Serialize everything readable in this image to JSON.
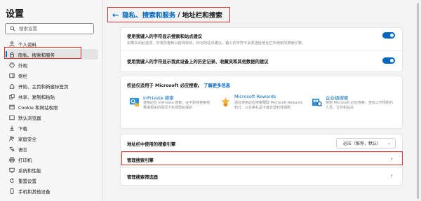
{
  "sidebar": {
    "title": "设置",
    "search_placeholder": "搜索设置",
    "items": [
      {
        "label": "个人资料",
        "icon": "profile-icon"
      },
      {
        "label": "隐私、搜索和服务",
        "icon": "lock-icon",
        "active": true
      },
      {
        "label": "外观",
        "icon": "appearance-icon"
      },
      {
        "label": "侧栏",
        "icon": "sidebar-icon"
      },
      {
        "label": "开始、主页和新建标签页",
        "icon": "home-icon"
      },
      {
        "label": "共享、复制和粘贴",
        "icon": "share-icon"
      },
      {
        "label": "Cookie 和网站权限",
        "icon": "cookie-icon"
      },
      {
        "label": "默认浏览器",
        "icon": "browser-icon"
      },
      {
        "label": "下载",
        "icon": "download-icon"
      },
      {
        "label": "家庭安全",
        "icon": "family-icon"
      },
      {
        "label": "语言",
        "icon": "language-icon"
      },
      {
        "label": "打印机",
        "icon": "printer-icon"
      },
      {
        "label": "系统和性能",
        "icon": "system-icon"
      },
      {
        "label": "重置设置",
        "icon": "reset-icon"
      },
      {
        "label": "手机和其他设备",
        "icon": "phone-icon"
      }
    ]
  },
  "header": {
    "back_glyph": "←",
    "crumb": "隐私、搜索和服务",
    "separator": "/",
    "current": "地址栏和搜索"
  },
  "suggestions": {
    "toggle1_label": "使用我键入的字符显示搜索和站点建议",
    "toggle1_desc": "如果关闭此选项，你将仅看到以前保存的、标记的站点建议。键入的字符不会发送给地址栏中使用的搜索引擎。",
    "toggle2_label": "使用我键入的字符显示我此设备上的历史记录、收藏夹和其他数据的建议"
  },
  "rewards": {
    "title": "权益仅适用于 Microsoft 必应搜索。",
    "link": "了解更多信息",
    "features": [
      {
        "title": "InPrivate 搜索",
        "text": "使用必应 InPrivate 搜索，在不影响搜索结果或相关的情况下实现隐私保护",
        "icon": "inprivate-search-icon"
      },
      {
        "title": "Microsoft Rewards",
        "text": "通过使用必应搜索赚取 Microsoft Rewards 积分，以兑换礼品卡或非营利性捐赠",
        "icon": "rewards-icon"
      },
      {
        "title": "企业级搜索",
        "text": "使用 Microsoft 必应搜索，查找工作场所的人员、文件和站点",
        "icon": "enterprise-search-icon"
      }
    ]
  },
  "engine": {
    "label": "地址栏中使用的搜索引擎",
    "value": "必应（推荐，默认）",
    "manage": "管理搜索引擎",
    "filters": "管理搜索筛选器"
  },
  "colors": {
    "accent": "#0067c0",
    "highlight": "#e03030"
  }
}
